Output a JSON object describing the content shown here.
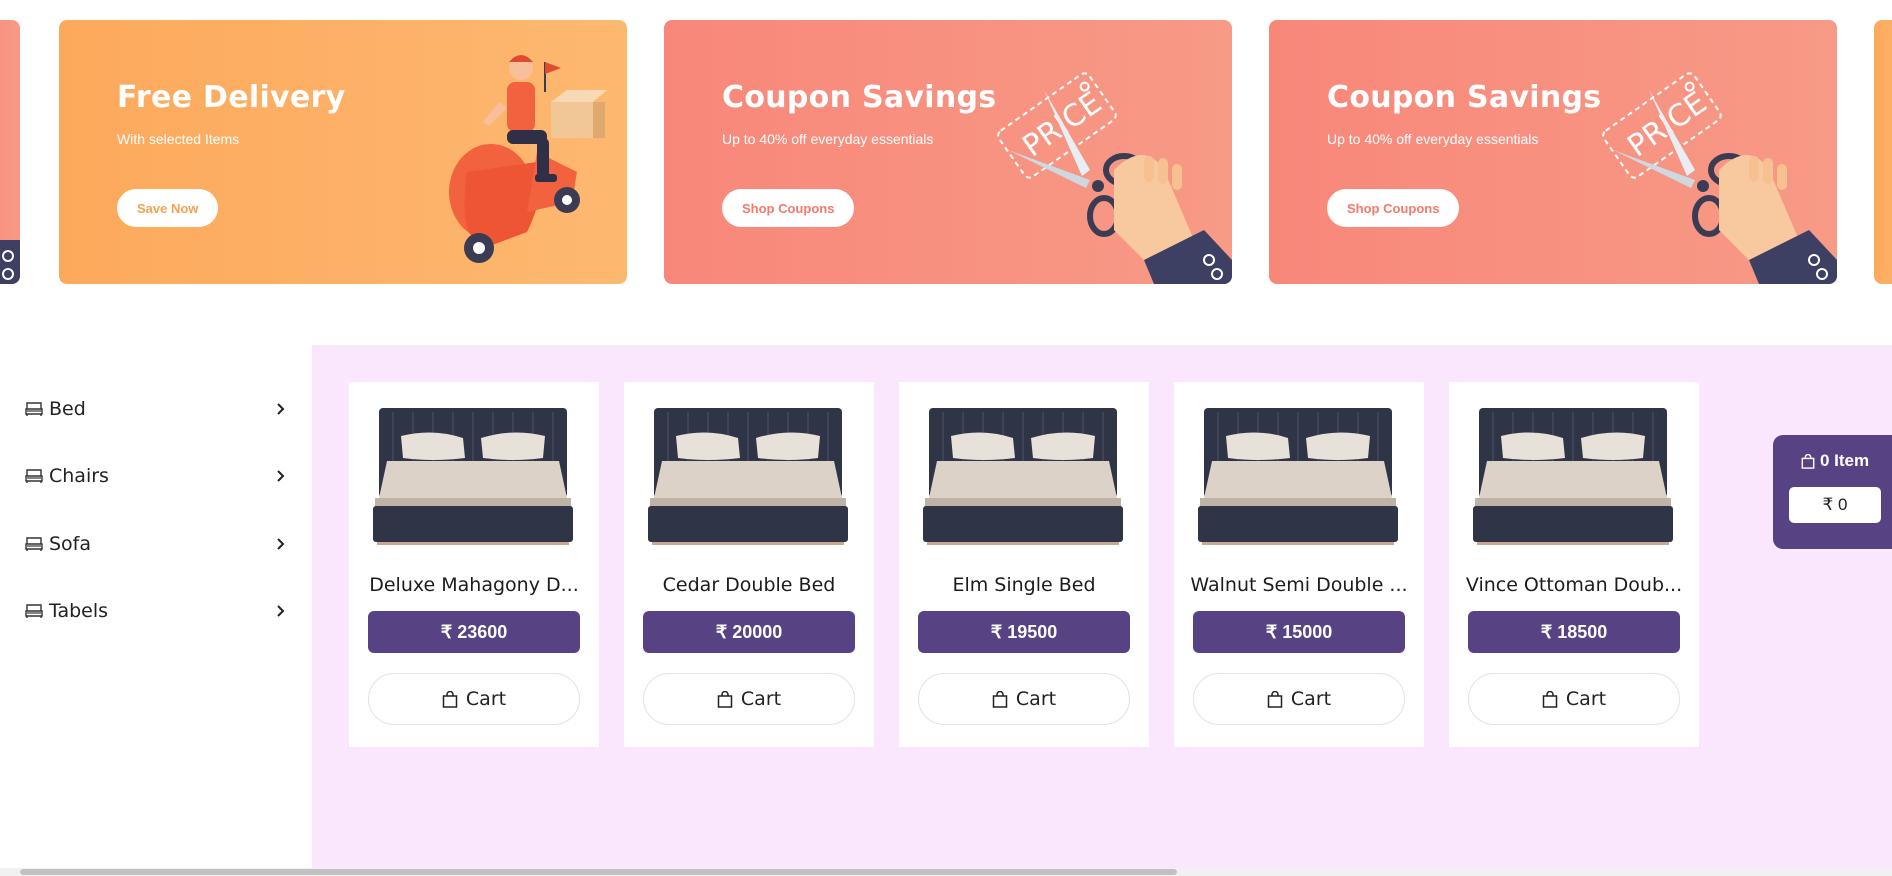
{
  "banners": [
    {
      "title": "Free Delivery",
      "subtitle": "With selected Items",
      "button": "Save Now"
    },
    {
      "title": "Coupon Savings",
      "subtitle": "Up to 40% off everyday essentials",
      "button": "Shop Coupons"
    },
    {
      "title": "Coupon Savings",
      "subtitle": "Up to 40% off everyday essentials",
      "button": "Shop Coupons"
    }
  ],
  "price_tag_text": "PRICE",
  "categories": [
    {
      "label": "Bed",
      "icon": "bed-icon"
    },
    {
      "label": "Chairs",
      "icon": "bed-icon"
    },
    {
      "label": "Sofa",
      "icon": "bed-icon"
    },
    {
      "label": "Tabels",
      "icon": "bed-icon"
    }
  ],
  "products": [
    {
      "name": "Deluxe Mahagony D...",
      "price": "₹ 23600",
      "cart_label": "Cart"
    },
    {
      "name": "Cedar Double Bed",
      "price": "₹ 20000",
      "cart_label": "Cart"
    },
    {
      "name": "Elm Single Bed",
      "price": "₹ 19500",
      "cart_label": "Cart"
    },
    {
      "name": "Walnut Semi Double ...",
      "price": "₹ 15000",
      "cart_label": "Cart"
    },
    {
      "name": "Vince Ottoman Doub...",
      "price": "₹ 18500",
      "cart_label": "Cart"
    }
  ],
  "mini_cart": {
    "count_label": "0 Item",
    "total": "₹ 0"
  },
  "colors": {
    "accent": "#574384",
    "background_pink": "#fae6fd",
    "banner_orange": "#fda95c",
    "banner_coral": "#f8877a"
  }
}
